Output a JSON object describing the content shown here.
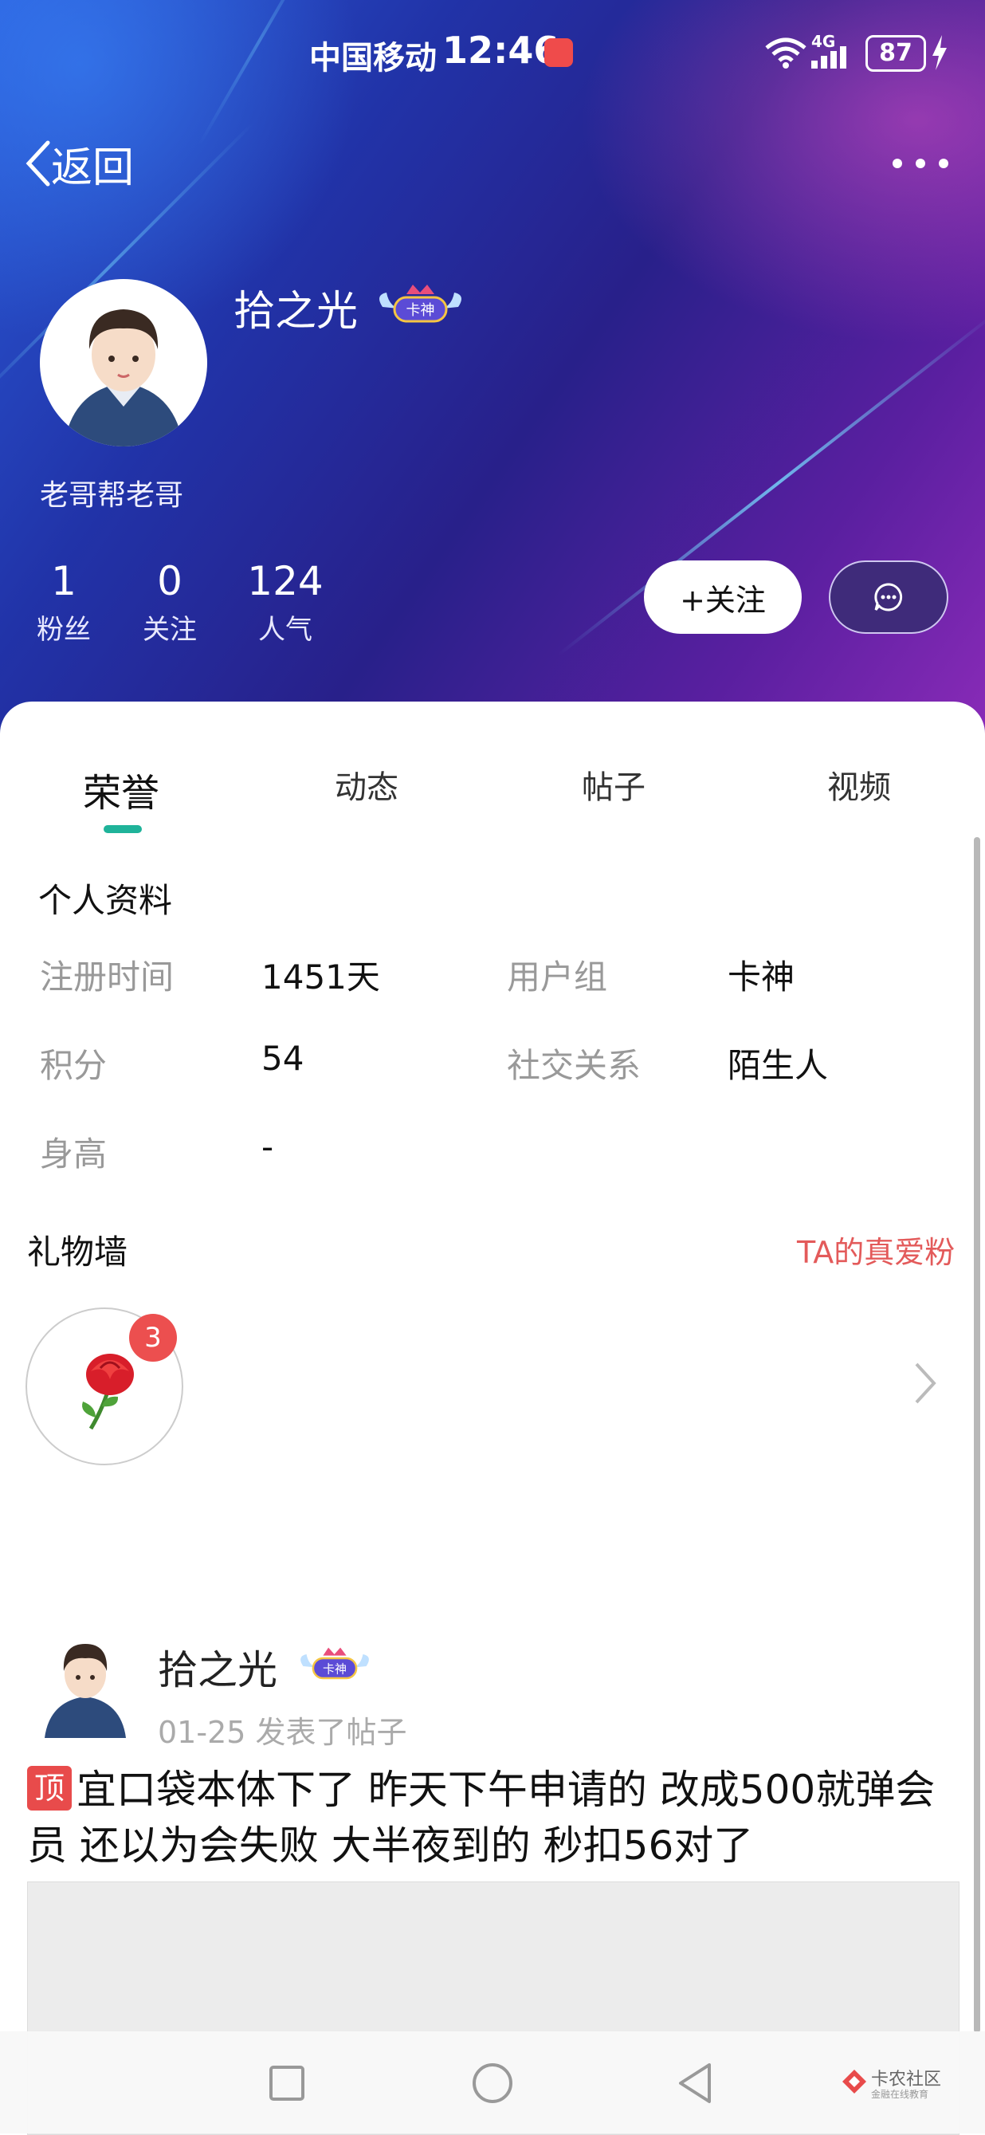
{
  "status_bar": {
    "carrier": "中国移动",
    "time": "12:46",
    "network": "4G",
    "battery": "87"
  },
  "nav": {
    "back_label": "返回"
  },
  "profile": {
    "name": "拾之光",
    "badge": "卡神",
    "tagline": "老哥帮老哥",
    "stats": [
      {
        "value": "1",
        "label": "粉丝"
      },
      {
        "value": "0",
        "label": "关注"
      },
      {
        "value": "124",
        "label": "人气"
      }
    ],
    "follow_label": "+关注"
  },
  "tabs": [
    {
      "label": "荣誉",
      "active": true
    },
    {
      "label": "动态",
      "active": false
    },
    {
      "label": "帖子",
      "active": false
    },
    {
      "label": "视频",
      "active": false
    }
  ],
  "personal_info": {
    "title": "个人资料",
    "rows": [
      {
        "label": "注册时间",
        "value": "1451天",
        "label2": "用户组",
        "value2": "卡神"
      },
      {
        "label": "积分",
        "value": "54",
        "label2": "社交关系",
        "value2": "陌生人"
      },
      {
        "label": "身高",
        "value": "-"
      }
    ]
  },
  "gift_wall": {
    "title": "礼物墙",
    "link": "TA的真爱粉",
    "count": "3",
    "gift_icon": "rose-icon"
  },
  "post": {
    "user": "拾之光",
    "badge": "卡神",
    "date": "01-25",
    "action": "发表了帖子",
    "pin_tag": "顶",
    "text": "宜口袋本体下了 昨天下午申请的 改成500就弹会员 还以为会失败 大半夜到的 秒扣56对了"
  },
  "watermark": {
    "title": "卡农社区",
    "subtitle": "金融在线教育"
  },
  "colors": {
    "accent": "#1fb39a",
    "link_red": "#e35a5a",
    "badge_red": "#ec4f4f"
  }
}
